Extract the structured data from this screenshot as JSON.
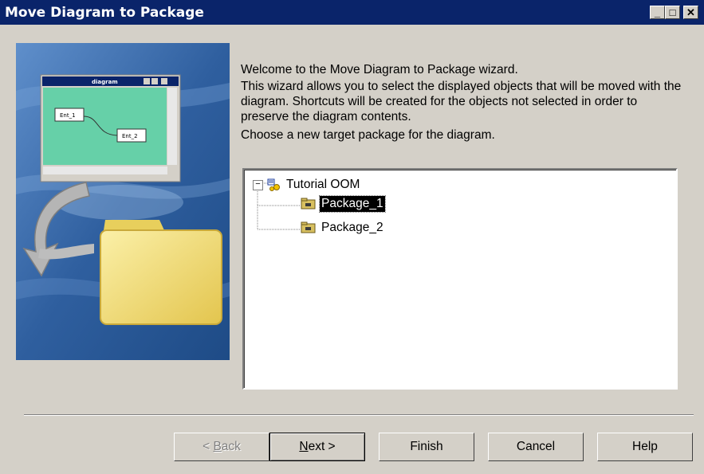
{
  "window": {
    "title": "Move Diagram to Package",
    "min_glyph": "_",
    "max_glyph": "□",
    "close_glyph": "✕"
  },
  "illustration": {
    "mini_title": "diagram",
    "box1": "Ent_1",
    "box2": "Ent_2"
  },
  "intro": {
    "line1": "Welcome to the Move Diagram to Package wizard.",
    "line2": "This wizard allows you to select the displayed objects that will be moved with the diagram. Shortcuts will be created for the objects not selected in order to preserve the diagram contents.",
    "line3": "Choose a new target package for the diagram."
  },
  "tree": {
    "root": "Tutorial OOM",
    "expander": "−",
    "items": [
      {
        "label": "Package_1",
        "selected": true
      },
      {
        "label": "Package_2",
        "selected": false
      }
    ]
  },
  "buttons": {
    "back": {
      "pre": "< ",
      "mnemonic": "B",
      "post": "ack"
    },
    "next": {
      "mnemonic": "N",
      "post": "ext >"
    },
    "finish": "Finish",
    "cancel": "Cancel",
    "help": "Help"
  },
  "colors": {
    "titlebar": "#0a246a",
    "dialog_bg": "#d4d0c8",
    "illustration_bg": "#3d6fae",
    "mini_diagram_bg": "#66d0a8",
    "folder": "#f3dd6c"
  }
}
